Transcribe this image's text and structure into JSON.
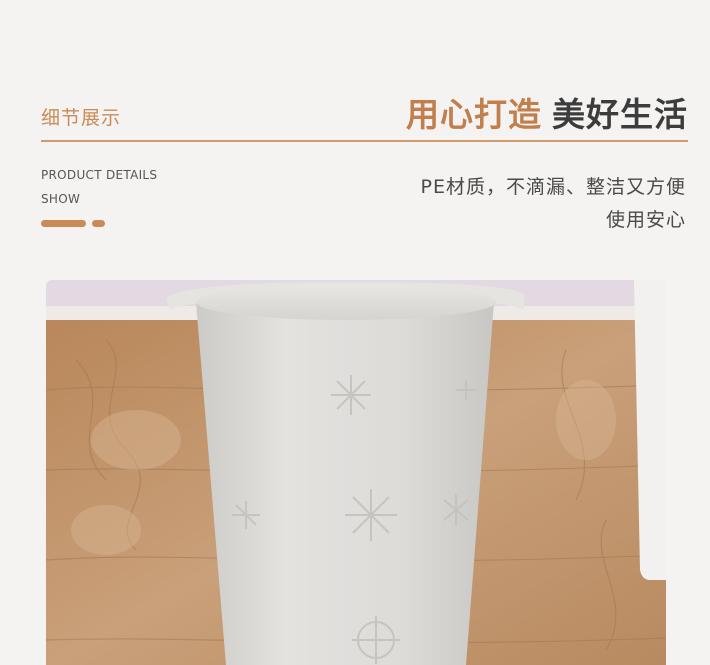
{
  "header": {
    "section_label": "细节展示",
    "headline_accent": "用心打造",
    "headline_dark": "美好生活",
    "sub_line1": "PRODUCT DETAILS",
    "sub_line2": "SHOW"
  },
  "description": {
    "line1": "PE材质，不滴漏、整洁又方便",
    "line2": "使用安心"
  },
  "colors": {
    "accent": "#c07f4c",
    "rule": "#cf9a6c",
    "background": "#f4f3f1"
  }
}
